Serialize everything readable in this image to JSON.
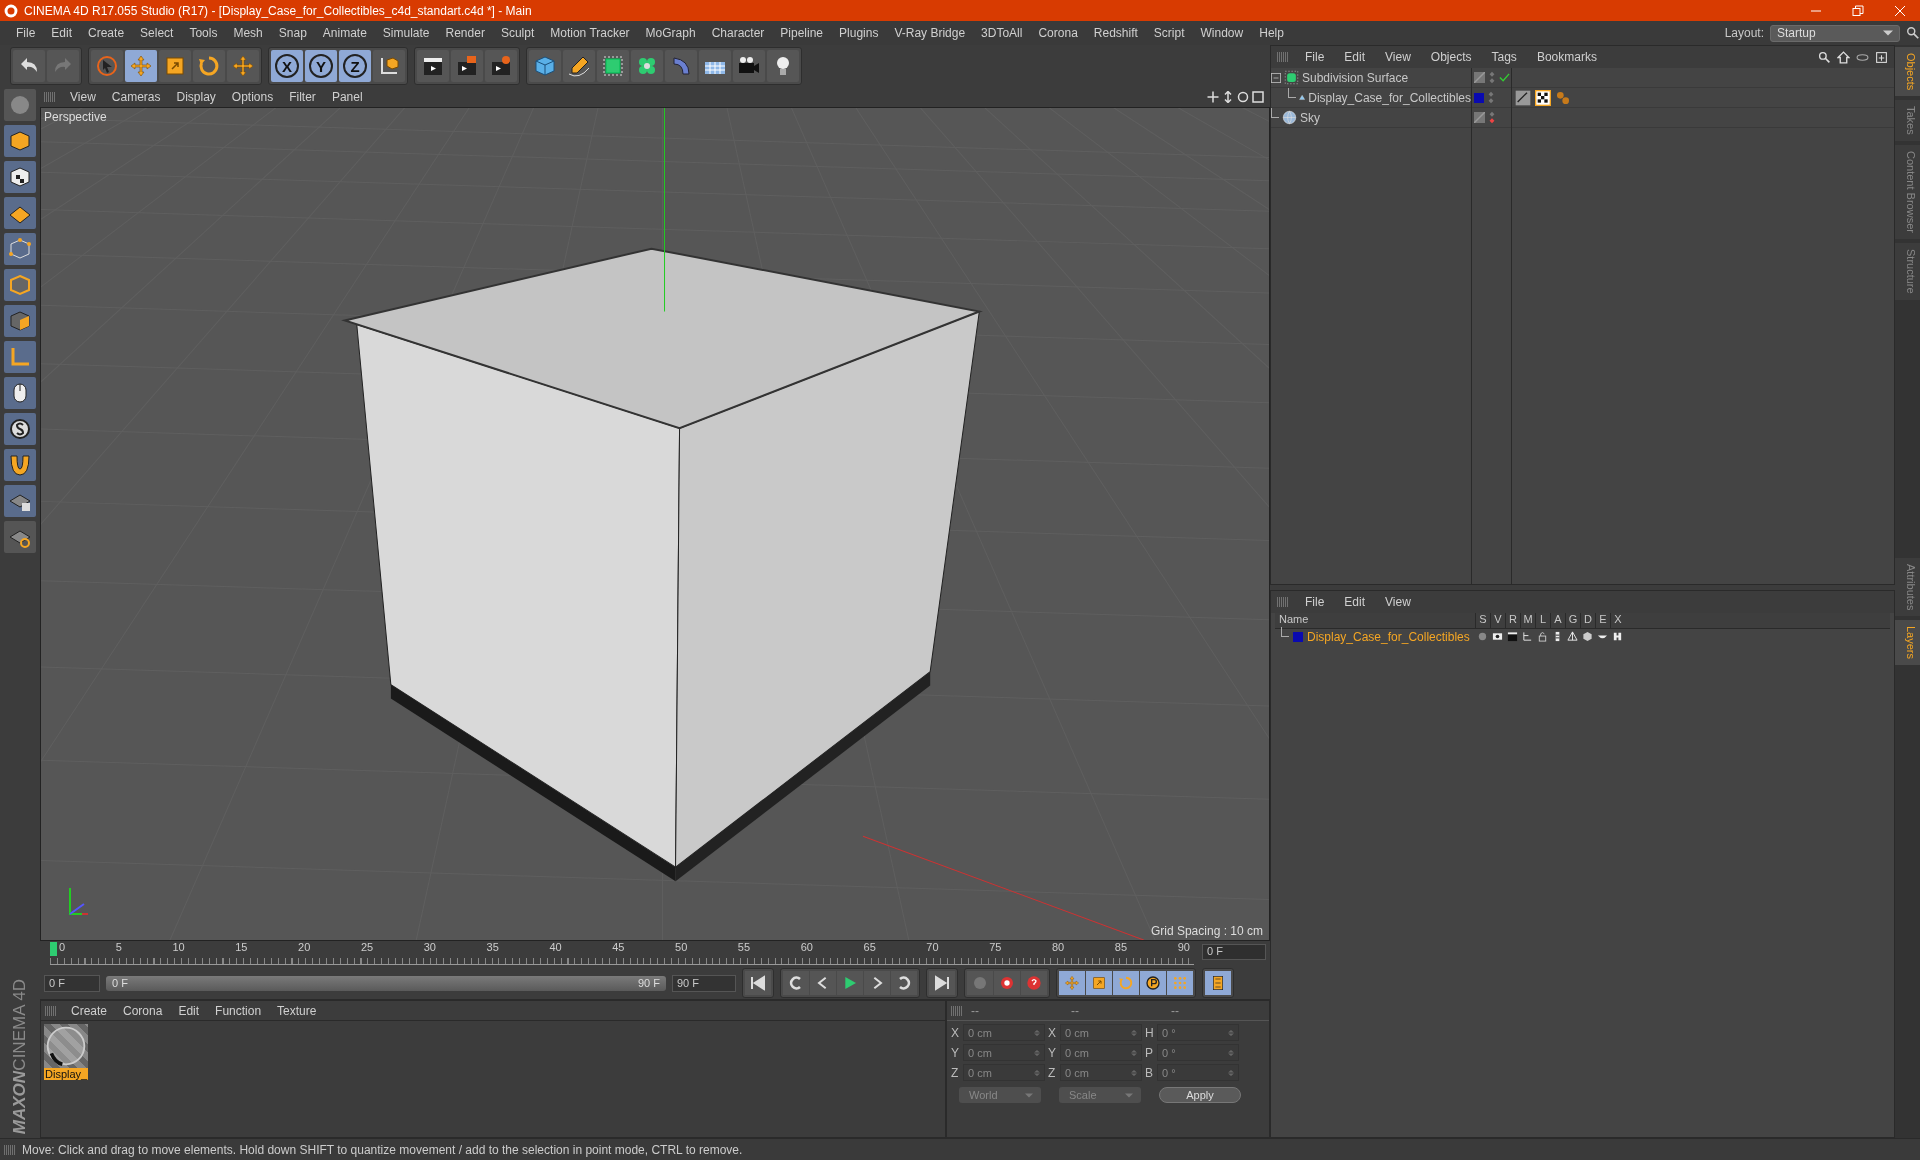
{
  "title_bar": {
    "title": "CINEMA 4D R17.055 Studio (R17) - [Display_Case_for_Collectibles_c4d_standart.c4d *] - Main"
  },
  "menu_bar": [
    "File",
    "Edit",
    "Create",
    "Select",
    "Tools",
    "Mesh",
    "Snap",
    "Animate",
    "Simulate",
    "Render",
    "Sculpt",
    "Motion Tracker",
    "MoGraph",
    "Character",
    "Pipeline",
    "Plugins",
    "V-Ray Bridge",
    "3DToAll",
    "Corona",
    "Redshift",
    "Script",
    "Window",
    "Help"
  ],
  "layout": {
    "label": "Layout:",
    "value": "Startup"
  },
  "tools": [
    {
      "kind": "select",
      "selected": false
    },
    {
      "kind": "move",
      "selected": true
    },
    {
      "kind": "scale",
      "selected": false
    },
    {
      "kind": "rotate",
      "selected": false
    },
    {
      "kind": "move",
      "selected": false
    }
  ],
  "axis_buttons": [
    {
      "label": "X",
      "selected": true
    },
    {
      "label": "Y",
      "selected": true
    },
    {
      "label": "Z",
      "selected": true
    }
  ],
  "brand": {
    "maker": "MAXON",
    "product": "CINEMA 4D"
  },
  "viewport": {
    "menu": [
      "View",
      "Cameras",
      "Display",
      "Options",
      "Filter",
      "Panel"
    ],
    "label": "Perspective",
    "grid_spacing": "Grid Spacing : 10 cm"
  },
  "timeline": {
    "ticks": [
      "0",
      "5",
      "10",
      "15",
      "20",
      "25",
      "30",
      "35",
      "40",
      "45",
      "50",
      "55",
      "60",
      "65",
      "70",
      "75",
      "80",
      "85",
      "90"
    ],
    "current_frame": "0 F",
    "start_field": "0 F",
    "range_start": "0 F",
    "range_end": "90 F",
    "range_slider": {
      "level": 1
    },
    "end_field": "90 F"
  },
  "material_manager": {
    "menu": [
      "Create",
      "Corona",
      "Edit",
      "Function",
      "Texture"
    ],
    "materials": [
      {
        "name": "Display_",
        "selected": true
      }
    ]
  },
  "coordinates": {
    "headers": [
      "--",
      "--",
      "--"
    ],
    "rows": [
      [
        {
          "axis": "X",
          "value": "0 cm"
        },
        {
          "axis": "X",
          "value": "0 cm"
        },
        {
          "axis": "H",
          "value": "0 °"
        }
      ],
      [
        {
          "axis": "Y",
          "value": "0 cm"
        },
        {
          "axis": "Y",
          "value": "0 cm"
        },
        {
          "axis": "P",
          "value": "0 °"
        }
      ],
      [
        {
          "axis": "Z",
          "value": "0 cm"
        },
        {
          "axis": "Z",
          "value": "0 cm"
        },
        {
          "axis": "B",
          "value": "0 °"
        }
      ]
    ],
    "dropdowns": [
      "World",
      "Scale"
    ],
    "apply": "Apply"
  },
  "object_manager": {
    "menu": [
      "File",
      "Edit",
      "View",
      "Objects",
      "Tags",
      "Bookmarks"
    ],
    "objects": [
      {
        "name": "Subdivision Surface",
        "kind": "subdivision",
        "enabled": true,
        "render_off": false,
        "expanded": true,
        "children": [
          {
            "name": "Display_Case_for_Collectibles",
            "kind": "polygon",
            "enabled": false,
            "render_off": false,
            "color": "#0a0ab0",
            "tags": [
              {
                "kind": "phong"
              },
              {
                "kind": "material"
              },
              {
                "kind": "spheres"
              }
            ]
          }
        ]
      },
      {
        "name": "Sky",
        "kind": "sky",
        "enabled": false,
        "render_off": true
      }
    ]
  },
  "layer_manager": {
    "menu": [
      "File",
      "Edit",
      "View"
    ],
    "columns": [
      "Name",
      "S",
      "V",
      "R",
      "M",
      "L",
      "A",
      "G",
      "D",
      "E",
      "X"
    ],
    "layers": [
      {
        "name": "Display_Case_for_Collectibles",
        "color": "#0a0ab0"
      }
    ]
  },
  "side_tabs_top": [
    {
      "label": "Objects",
      "selected": true
    },
    {
      "label": "Takes",
      "selected": false
    },
    {
      "label": "Content Browser",
      "selected": false
    },
    {
      "label": "Structure",
      "selected": false
    }
  ],
  "side_tabs_bottom": [
    {
      "label": "Attributes",
      "selected": false
    },
    {
      "label": "Layers",
      "selected": true
    }
  ],
  "status_bar": "Move: Click and drag to move elements. Hold down SHIFT to quantize movement / add to the selection in point mode, CTRL to remove."
}
